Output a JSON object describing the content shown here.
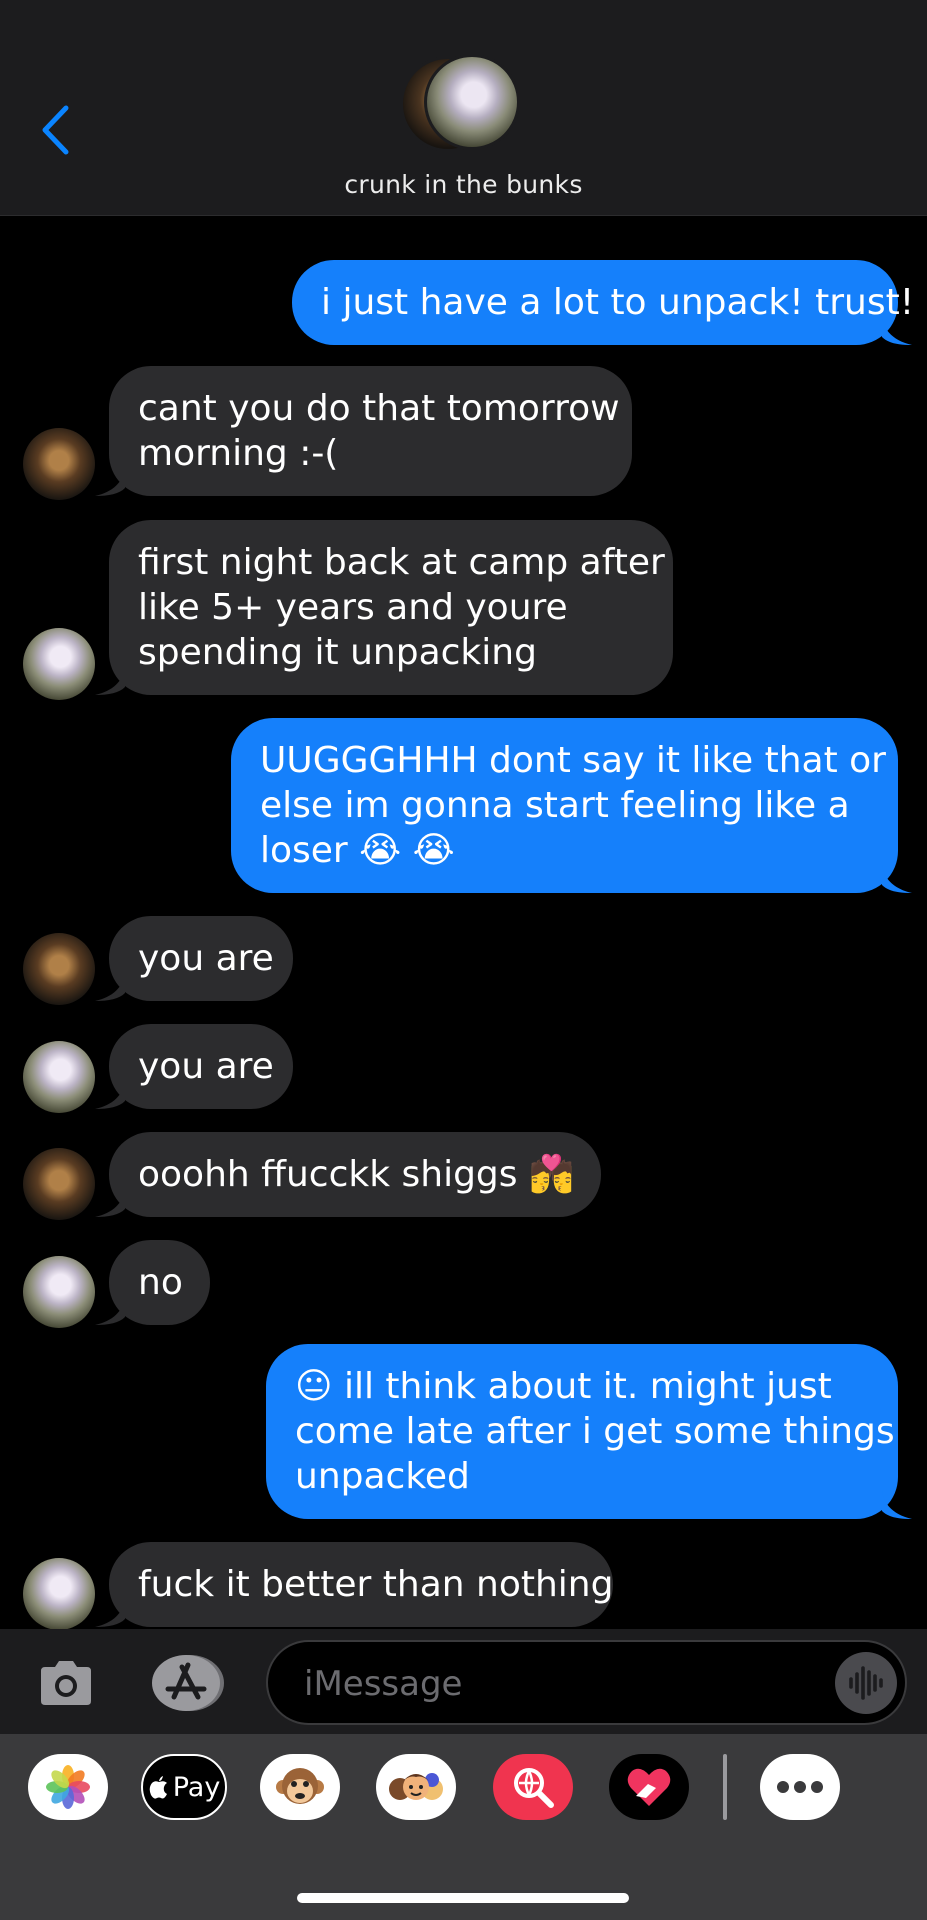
{
  "header": {
    "back_icon": "chevron-left-icon",
    "group_name": "crunk in the bunks"
  },
  "messages": [
    {
      "direction": "out",
      "text_lines": [
        "i just have a lot to unpack! trust!"
      ]
    },
    {
      "direction": "in",
      "sender_avatar": "cat-a",
      "text_lines": [
        "cant you do that tomorrow",
        "morning :-("
      ]
    },
    {
      "direction": "in",
      "sender_avatar": "cat-b",
      "text_lines": [
        "first night back at camp after",
        "like 5+ years and youre",
        "spending it unpacking"
      ]
    },
    {
      "direction": "out",
      "text_lines": [
        "UUGGGHHH dont say it like that or",
        "else im gonna start feeling like a",
        "loser 😭 😭"
      ]
    },
    {
      "direction": "in",
      "sender_avatar": "cat-a",
      "text_lines": [
        "you are"
      ]
    },
    {
      "direction": "in",
      "sender_avatar": "cat-b",
      "text_lines": [
        "you are"
      ]
    },
    {
      "direction": "in",
      "sender_avatar": "cat-a",
      "text_lines": [
        "ooohh ffucckk shiggs 💏"
      ]
    },
    {
      "direction": "in",
      "sender_avatar": "cat-b",
      "text_lines": [
        "no"
      ]
    },
    {
      "direction": "out",
      "text_lines": [
        "😐 ill think about it. might just",
        "come late after i get some things",
        "unpacked"
      ]
    },
    {
      "direction": "in",
      "sender_avatar": "cat-b",
      "text_lines": [
        "fuck it better than nothing"
      ]
    }
  ],
  "input": {
    "camera_icon": "camera-icon",
    "apps_icon": "app-store-icon",
    "placeholder": "iMessage",
    "audio_icon": "waveform-icon"
  },
  "drawer": {
    "apps": [
      {
        "name": "photos",
        "icon": "photos-icon"
      },
      {
        "name": "apple-pay",
        "label": "Pay",
        "icon": "apple-pay-icon"
      },
      {
        "name": "animoji",
        "icon": "monkey-animoji-icon"
      },
      {
        "name": "memoji",
        "icon": "memoji-stickers-icon"
      },
      {
        "name": "search-images",
        "icon": "image-search-icon"
      },
      {
        "name": "digital-touch",
        "icon": "digital-touch-heart-icon"
      },
      {
        "name": "more",
        "icon": "more-dots-icon"
      }
    ]
  },
  "colors": {
    "outgoing_bubble": "#1580fb",
    "incoming_bubble": "#2c2c2e",
    "accent_blue": "#0a84ff"
  }
}
